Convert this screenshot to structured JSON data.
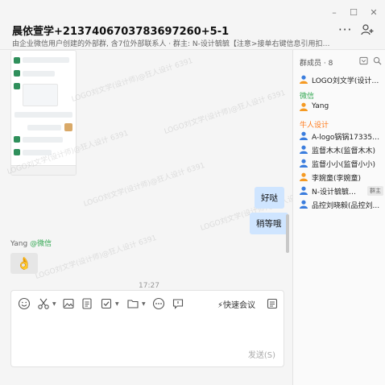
{
  "header": {
    "title": "晨依萱学+2137406703783697260+5-1",
    "subtitle": "由企业微信用户创建的外部群, 含7位外部联系人 · 群主: N-设计毓毓【注意>接单右键信息引用扣1】(...",
    "minimize": "–",
    "maximize": "☐",
    "close": "✕",
    "more": "···"
  },
  "watermark": "LOGO刘文学(设计师)@狂人设计 6391",
  "messages": {
    "outgoing": [
      "好哒",
      "稍等哦"
    ],
    "sender_name": "Yang",
    "sender_tag": "@微信",
    "emoji": "👌",
    "timestamp": "17:27"
  },
  "composer": {
    "meeting_label": "快速会议",
    "send_label": "发送(S)"
  },
  "members": {
    "header": "群成员 · 8",
    "owner_badge": "群主",
    "top": "LOGO刘文学(设计师)",
    "wechat_label": "微信",
    "wechat": [
      "Yang"
    ],
    "org_label": "牛人设计",
    "org": [
      "A-logo锅锅173357...",
      "监督木木(监督木木)",
      "监督小小(监督小小)",
      "李婉童(李婉童)",
      "N-设计毓毓【...",
      "品控刘晓毅(品控刘..."
    ]
  },
  "colors": {
    "accent": "#1677ff",
    "bubble": "#cfe5ff",
    "wechat_green": "#34a853",
    "org_orange": "#ff7a1a",
    "avatar_orange": "#f59a23",
    "avatar_blue": "#3b7ddd"
  }
}
